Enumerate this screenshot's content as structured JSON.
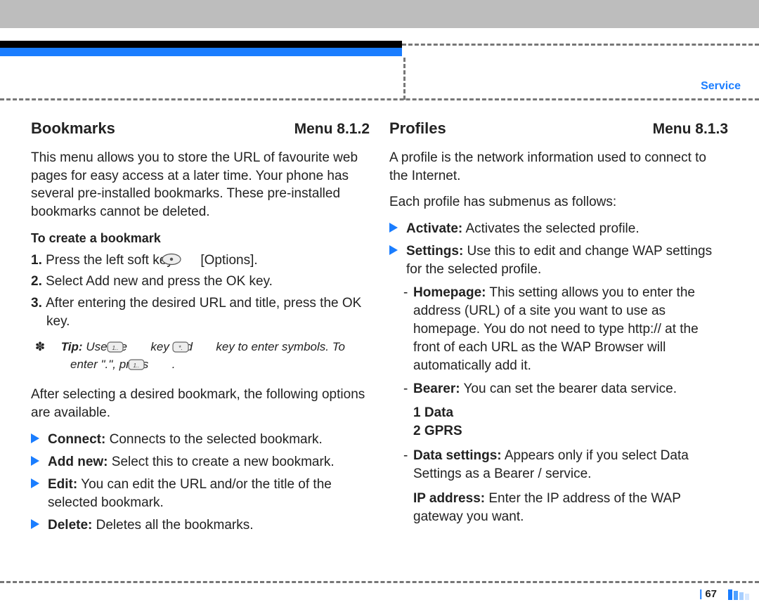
{
  "header": {
    "tab_label": "Service"
  },
  "footer": {
    "page_number": "67"
  },
  "left": {
    "title": "Bookmarks",
    "menu": "Menu 8.1.2",
    "intro": "This menu allows you to store the URL of favourite web pages for easy access at a later time. Your phone has several pre-installed bookmarks. These pre-installed bookmarks cannot be deleted.",
    "create_heading": "To create a bookmark",
    "steps": {
      "s1a": "Press the left soft key ",
      "s1b": " [Options].",
      "s2": "Select Add new and press the OK key.",
      "s3": "After entering the desired URL and title, press the OK key."
    },
    "tip_label": "Tip:",
    "tip_a": " Use the ",
    "tip_b": " key and ",
    "tip_c": " key to enter symbols. To enter \".\", press ",
    "tip_d": " .",
    "after_select": "After selecting a desired bookmark, the following options are available.",
    "opts": {
      "connect": {
        "label": "Connect:",
        "text": " Connects to the selected bookmark."
      },
      "addnew": {
        "label": "Add new:",
        "text": " Select this to create a new bookmark."
      },
      "edit": {
        "label": "Edit:",
        "text": " You can edit the URL and/or the title of the selected bookmark."
      },
      "delete": {
        "label": "Delete:",
        "text": " Deletes all the bookmarks."
      }
    }
  },
  "right": {
    "title": "Profiles",
    "menu": "Menu 8.1.3",
    "intro1": "A profile is the network information used to connect to the Internet.",
    "intro2": "Each profile has submenus as follows:",
    "activate": {
      "label": "Activate:",
      "text": " Activates the selected profile."
    },
    "settings": {
      "label": "Settings:",
      "text": " Use this to edit and change WAP settings for the selected profile."
    },
    "homepage": {
      "label": "Homepage:",
      "text": " This setting allows you to enter the address (URL) of a site you want to use as homepage. You do not need to type http:// at the front of each URL as the WAP Browser will automatically add it."
    },
    "bearer": {
      "label": "Bearer:",
      "text": " You can set the bearer data service."
    },
    "bearer_1": "1 Data",
    "bearer_2": "2 GPRS",
    "datasettings": {
      "label": "Data settings:",
      "text": " Appears only if you select Data Settings as a Bearer / service."
    },
    "ip": {
      "label": "IP address:",
      "text": " Enter the IP address of the WAP gateway you want."
    }
  }
}
